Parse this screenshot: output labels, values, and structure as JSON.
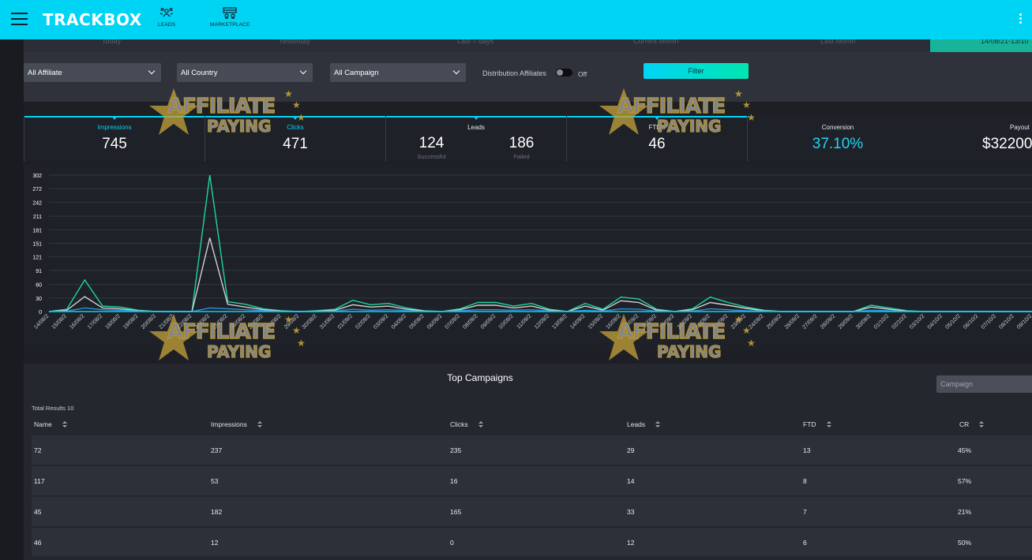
{
  "brand": "TRACKBOX",
  "nav": [
    {
      "label": "LEADS",
      "icon": "leads-icon"
    },
    {
      "label": "MARKETPLACE",
      "icon": "marketplace-icon"
    }
  ],
  "date_tabs": [
    "Today",
    "Yesterday",
    "Last 7 days",
    "Current Month",
    "Last Month"
  ],
  "date_custom": "14/08/21-13/10",
  "filters": {
    "affiliate": "All Affiliate",
    "country": "All Country",
    "campaign": "All Campaign",
    "distribution_label": "Distribution Affiliates",
    "distribution_state": "Off",
    "button": "Filter"
  },
  "stats": {
    "impressions_label": "Impressions",
    "impressions": "745",
    "clicks_label": "Clicks",
    "clicks": "471",
    "leads_label": "Leads",
    "leads_successful": "124",
    "leads_successful_label": "Successful",
    "leads_failed": "186",
    "leads_failed_label": "Failed",
    "ftd_label": "FTD's",
    "ftd": "46",
    "conversion_label": "Conversion",
    "conversion": "37.10%",
    "payout_label": "Payout",
    "payout": "$32200"
  },
  "watermark": {
    "line1": "AFFILIATE",
    "line2": "PAYING"
  },
  "colors": {
    "accent": "#00d4f5",
    "green": "#00e5b0",
    "series_gray": "#d0d0d0",
    "series_cyan": "#2f8fd8"
  },
  "chart_data": {
    "type": "line",
    "ylim": [
      0,
      302
    ],
    "yticks": [
      0,
      30,
      60,
      91,
      121,
      151,
      181,
      211,
      242,
      272,
      302
    ],
    "x": [
      "14/08/2",
      "15/08/2",
      "16/08/2",
      "17/08/2",
      "18/08/2",
      "19/08/2",
      "20/08/2",
      "21/08/2",
      "22/08/2",
      "24/08/2",
      "25/08/2",
      "26/08/2",
      "27/08/2",
      "28/08/2",
      "29/08/2",
      "30/08/2",
      "31/08/2",
      "01/09/2",
      "02/09/2",
      "03/09/2",
      "04/09/2",
      "05/09/2",
      "06/09/2",
      "07/09/2",
      "08/09/2",
      "09/09/2",
      "10/09/2",
      "11/09/2",
      "12/09/2",
      "13/09/2",
      "14/09/2",
      "15/09/2",
      "16/09/2",
      "17/09/2",
      "18/09/2",
      "19/09/2",
      "20/09/2",
      "21/09/2",
      "22/09/2",
      "23/09/2",
      "24/09/2",
      "25/09/2",
      "26/09/2",
      "27/09/2",
      "28/09/2",
      "29/09/2",
      "30/09/2",
      "01/10/2",
      "02/10/2",
      "03/10/2",
      "04/10/2",
      "05/10/2",
      "06/10/2",
      "07/10/2",
      "08/10/2",
      "09/10/2"
    ],
    "series": [
      {
        "values": [
          0,
          5,
          70,
          12,
          10,
          3,
          0,
          0,
          0,
          302,
          22,
          16,
          6,
          2,
          0,
          2,
          5,
          25,
          15,
          18,
          8,
          2,
          0,
          6,
          20,
          20,
          12,
          18,
          5,
          0,
          18,
          5,
          32,
          28,
          5,
          0,
          6,
          32,
          20,
          10,
          3,
          0,
          0,
          0,
          0,
          0,
          14,
          8,
          2,
          0,
          0,
          0,
          0,
          0,
          0,
          0
        ],
        "color": "#1fd6a0"
      },
      {
        "values": [
          0,
          3,
          33,
          8,
          6,
          2,
          0,
          0,
          0,
          163,
          16,
          10,
          4,
          1,
          0,
          1,
          3,
          15,
          10,
          12,
          5,
          1,
          0,
          4,
          14,
          14,
          8,
          12,
          3,
          0,
          12,
          3,
          24,
          20,
          3,
          0,
          4,
          20,
          14,
          7,
          2,
          0,
          0,
          0,
          0,
          0,
          10,
          5,
          1,
          0,
          0,
          0,
          0,
          0,
          0,
          0
        ],
        "color": "#d0d0d0"
      },
      {
        "values": [
          0,
          1,
          8,
          4,
          3,
          1,
          0,
          0,
          0,
          8,
          6,
          4,
          2,
          0,
          0,
          0,
          1,
          5,
          3,
          4,
          2,
          0,
          0,
          2,
          4,
          4,
          3,
          4,
          1,
          0,
          3,
          1,
          6,
          5,
          1,
          0,
          1,
          6,
          4,
          2,
          1,
          0,
          0,
          0,
          0,
          0,
          3,
          2,
          0,
          0,
          0,
          0,
          0,
          0,
          0,
          0
        ],
        "color": "#2f8fd8"
      }
    ]
  },
  "table": {
    "title": "Top Campaigns",
    "search_placeholder": "Campaign",
    "total": "Total Results 10",
    "headers": [
      "Name",
      "Impressions",
      "Clicks",
      "Leads",
      "FTD",
      "CR"
    ],
    "rows": [
      [
        "72",
        "237",
        "235",
        "29",
        "13",
        "45%"
      ],
      [
        "117",
        "53",
        "16",
        "14",
        "8",
        "57%"
      ],
      [
        "45",
        "182",
        "165",
        "33",
        "7",
        "21%"
      ],
      [
        "46",
        "12",
        "0",
        "12",
        "6",
        "50%"
      ]
    ]
  }
}
